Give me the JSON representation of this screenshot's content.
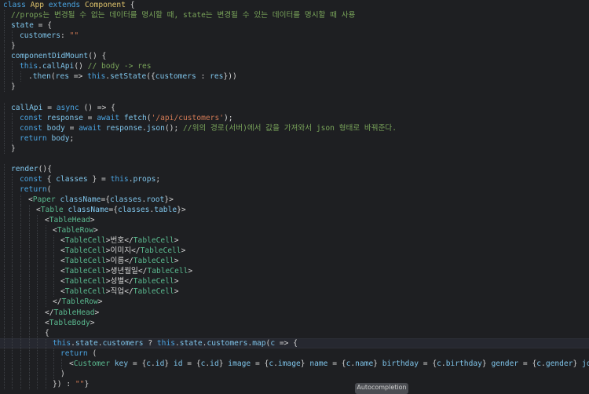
{
  "editor": {
    "lines": [
      {
        "text": "class App extends Component {",
        "indent": 0
      },
      {
        "text": "//props는 변경될 수 없는 데이터를 명시할 때, state는 변경될 수 있는 데이터를 명시할 때 사용",
        "indent": 1
      },
      {
        "text": "state = {",
        "indent": 1
      },
      {
        "text": "customers: \"\"",
        "indent": 2
      },
      {
        "text": "}",
        "indent": 1
      },
      {
        "text": "componentDidMount() {",
        "indent": 1
      },
      {
        "text": "this.callApi() // body -> res",
        "indent": 2
      },
      {
        "text": ".then(res => this.setState({customers : res}))",
        "indent": 3
      },
      {
        "text": "}",
        "indent": 1
      },
      {
        "text": "",
        "indent": 0
      },
      {
        "text": "callApi = async () => {",
        "indent": 1
      },
      {
        "text": "const response = await fetch('/api/customers');",
        "indent": 2
      },
      {
        "text": "const body = await response.json(); //위의 경로(서버)에서 값을 가져와서 json 형태로 바꿔준다.",
        "indent": 2
      },
      {
        "text": "return body;",
        "indent": 2
      },
      {
        "text": "}",
        "indent": 1
      },
      {
        "text": "",
        "indent": 0
      },
      {
        "text": "render(){",
        "indent": 1
      },
      {
        "text": "const { classes } = this.props;",
        "indent": 2
      },
      {
        "text": "return(",
        "indent": 2
      },
      {
        "text": "<Paper className={classes.root}>",
        "indent": 3
      },
      {
        "text": "<Table className={classes.table}>",
        "indent": 4
      },
      {
        "text": "<TableHead>",
        "indent": 5
      },
      {
        "text": "<TableRow>",
        "indent": 6
      },
      {
        "text": "<TableCell>번호</TableCell>",
        "indent": 7
      },
      {
        "text": "<TableCell>이미지</TableCell>",
        "indent": 7
      },
      {
        "text": "<TableCell>이름</TableCell>",
        "indent": 7
      },
      {
        "text": "<TableCell>생년월일</TableCell>",
        "indent": 7
      },
      {
        "text": "<TableCell>성별</TableCell>",
        "indent": 7
      },
      {
        "text": "<TableCell>직업</TableCell>",
        "indent": 7
      },
      {
        "text": "</TableRow>",
        "indent": 6
      },
      {
        "text": "</TableHead>",
        "indent": 5
      },
      {
        "text": "<TableBody>",
        "indent": 5
      },
      {
        "text": "{",
        "indent": 5
      },
      {
        "text": "this.state.customers ? this.state.customers.map(c => {",
        "indent": 6
      },
      {
        "text": "return (",
        "indent": 7
      },
      {
        "text": "<Customer key = {c.id} id = {c.id} image = {c.image} name = {c.name} birthday = {c.birthday} gender = {c.gender} job = {c.job",
        "indent": 8
      },
      {
        "text": ")",
        "indent": 7
      },
      {
        "text": "}) : \"\"}",
        "indent": 6
      }
    ]
  },
  "tooltip": {
    "label": "Autocompletion"
  }
}
